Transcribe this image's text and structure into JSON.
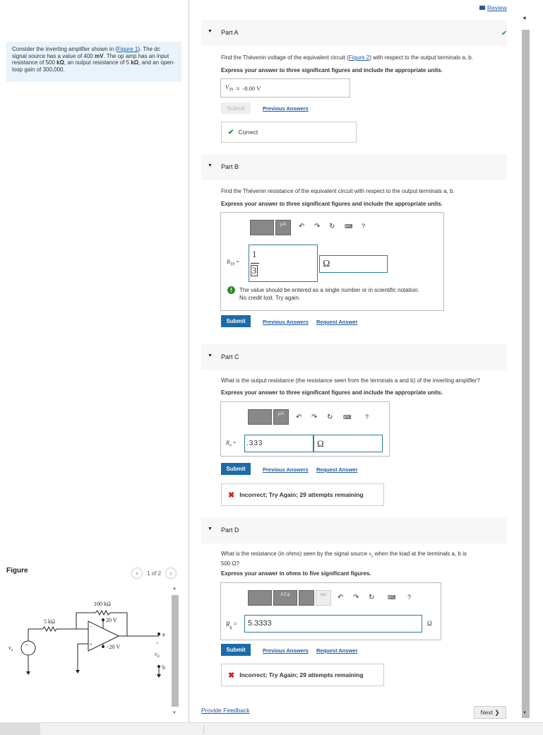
{
  "header": {
    "review_label": "Review"
  },
  "problem": {
    "text_a": "Consider the inverting amplifier shown in (",
    "figure_link": "Figure 1",
    "text_b": "). The dc signal source has a value of 400 ",
    "mv": "mV",
    "text_c": ". The op amp has an input resistance of 500 ",
    "kohm1": "kΩ",
    "text_d": ", an output resistance of 5 ",
    "kohm2": "kΩ",
    "text_e": ", and an open-loop gain of 300,000."
  },
  "figure": {
    "title": "Figure",
    "pager": "1 of 2",
    "prev_icon": "chevron-left",
    "next_icon": "chevron-right",
    "labels": {
      "r1": "100 kΩ",
      "r2": "5 kΩ",
      "vpos": "20 V",
      "vneg": "−20 V",
      "a": "a",
      "b": "b",
      "vo": "v",
      "vo_sub": "o",
      "vs": "v",
      "vs_sub": "s",
      "plus": "+",
      "minus": "−",
      "src_plus": "+"
    }
  },
  "partA": {
    "title": "Part A",
    "question_a": "Find the Thévenin voltage of the equivalent circuit (",
    "figure_link": "Figure 2",
    "question_b": ") with respect to the output terminals a, b.",
    "instruction": "Express your answer to three significant figures and include the appropriate units.",
    "answer_label": "V",
    "answer_label_sub": "Th",
    "answer_eq": "=",
    "answer_value": "-8.00 V",
    "submit": "Submit",
    "previous": "Previous Answers",
    "feedback": "Correct"
  },
  "partB": {
    "title": "Part B",
    "question": "Find the Thévenin resistance of the equivalent circuit with respect to the output terminals a, b.",
    "instruction": "Express your answer to three significant figures and include the appropriate units.",
    "toolbar_mu": "μA",
    "help": "?",
    "answer_label": "R",
    "answer_label_sub": "Th",
    "answer_eq": "=",
    "numerator": "1",
    "denominator": "3",
    "unit": "Ω",
    "error_line1": "The value should be entered as a single number or in scientific notation.",
    "error_line2": "No credit lost. Try again.",
    "submit": "Submit",
    "previous": "Previous Answers",
    "request": "Request Answer"
  },
  "partC": {
    "title": "Part C",
    "question": "What is the output resistance (the resistance seen from the terminals a and b) of the inverting amplifier?",
    "instruction": "Express your answer to three significant figures and include the appropriate units.",
    "toolbar_mu": "μA",
    "help": "?",
    "answer_label": "R",
    "answer_label_sub": "o",
    "answer_eq": "=",
    "answer_value": ".333",
    "unit": "Ω",
    "submit": "Submit",
    "previous": "Previous Answers",
    "request": "Request Answer",
    "feedback": "Incorrect; Try Again; 29 attempts remaining"
  },
  "partD": {
    "title": "Part D",
    "question_a": "What is the resistance (in ohms) seen by the signal source ",
    "question_vs": "v",
    "question_vs_sub": "s",
    "question_b": " when the load at the terminals a, b is",
    "question_c": "500 Ω?",
    "instruction": "Express your answer in ohms to five significant figures.",
    "toolbar_sym": "ΑΣφ",
    "toolbar_vec": "vec",
    "help": "?",
    "answer_label": "R",
    "answer_label_sub": "g",
    "answer_eq": "=",
    "answer_value": "5.3333",
    "unit": "Ω",
    "submit": "Submit",
    "previous": "Previous Answers",
    "request": "Request Answer",
    "feedback": "Incorrect; Try Again; 29 attempts remaining"
  },
  "footer": {
    "feedback_link": "Provide Feedback",
    "next": "Next ❯"
  },
  "colors": {
    "accent": "#1c6ba8",
    "correct": "#2e8b2e",
    "incorrect": "#cc2222",
    "link": "#1a5aa6"
  }
}
